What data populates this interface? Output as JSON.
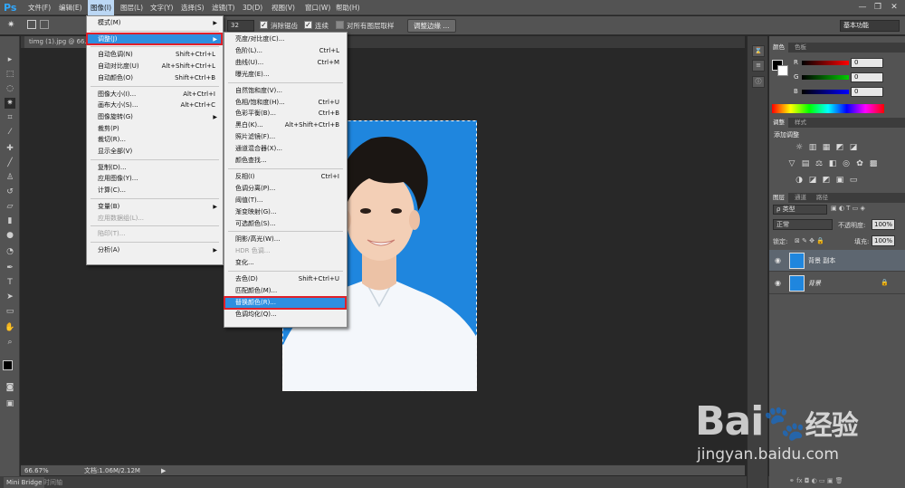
{
  "app": {
    "logo": "Ps"
  },
  "menubar": {
    "items": [
      "文件(F)",
      "编辑(E)",
      "图像(I)",
      "图层(L)",
      "文字(Y)",
      "选择(S)",
      "滤镜(T)",
      "3D(D)",
      "视图(V)",
      "窗口(W)",
      "帮助(H)"
    ],
    "active_index": 2,
    "window_controls": [
      "—",
      "❐",
      "✕"
    ]
  },
  "options": {
    "tolerance": "32",
    "antialias_label": "消除锯齿",
    "contiguous_label": "连续",
    "sample_all_label": "对所有图层取样",
    "refine_edge_label": "调整边缘 ...",
    "workspace_value": "基本功能"
  },
  "document": {
    "tab_title": "timg (1).jpg @ 66.7..."
  },
  "status": {
    "zoom": "66.67%",
    "doc_info": "文档:1.06M/2.12M"
  },
  "bottom_tabs": [
    "Mini Bridge",
    "时间轴"
  ],
  "image_menu": {
    "items": [
      {
        "label": "模式(M)",
        "submenu": true
      },
      {
        "sep": true
      },
      {
        "label": "调整(J)",
        "submenu": true,
        "highlight": true
      },
      {
        "sep": true
      },
      {
        "label": "自动色调(N)",
        "shortcut": "Shift+Ctrl+L"
      },
      {
        "label": "自动对比度(U)",
        "shortcut": "Alt+Shift+Ctrl+L"
      },
      {
        "label": "自动颜色(O)",
        "shortcut": "Shift+Ctrl+B"
      },
      {
        "sep": true
      },
      {
        "label": "图像大小(I)...",
        "shortcut": "Alt+Ctrl+I"
      },
      {
        "label": "画布大小(S)...",
        "shortcut": "Alt+Ctrl+C"
      },
      {
        "label": "图像旋转(G)",
        "submenu": true
      },
      {
        "label": "裁剪(P)"
      },
      {
        "label": "裁切(R)..."
      },
      {
        "label": "显示全部(V)"
      },
      {
        "sep": true
      },
      {
        "label": "复制(D)..."
      },
      {
        "label": "应用图像(Y)..."
      },
      {
        "label": "计算(C)..."
      },
      {
        "sep": true
      },
      {
        "label": "变量(B)",
        "submenu": true
      },
      {
        "label": "应用数据组(L)...",
        "disabled": true
      },
      {
        "sep": true
      },
      {
        "label": "陷印(T)...",
        "disabled": true
      },
      {
        "sep": true
      },
      {
        "label": "分析(A)",
        "submenu": true
      }
    ]
  },
  "adjust_menu": {
    "items": [
      {
        "label": "亮度/对比度(C)..."
      },
      {
        "label": "色阶(L)...",
        "shortcut": "Ctrl+L"
      },
      {
        "label": "曲线(U)...",
        "shortcut": "Ctrl+M"
      },
      {
        "label": "曝光度(E)..."
      },
      {
        "sep": true
      },
      {
        "label": "自然饱和度(V)..."
      },
      {
        "label": "色相/饱和度(H)...",
        "shortcut": "Ctrl+U"
      },
      {
        "label": "色彩平衡(B)...",
        "shortcut": "Ctrl+B"
      },
      {
        "label": "黑白(K)...",
        "shortcut": "Alt+Shift+Ctrl+B"
      },
      {
        "label": "照片滤镜(F)..."
      },
      {
        "label": "通道混合器(X)..."
      },
      {
        "label": "颜色查找..."
      },
      {
        "sep": true
      },
      {
        "label": "反相(I)",
        "shortcut": "Ctrl+I"
      },
      {
        "label": "色调分离(P)..."
      },
      {
        "label": "阈值(T)..."
      },
      {
        "label": "渐变映射(G)..."
      },
      {
        "label": "可选颜色(S)..."
      },
      {
        "sep": true
      },
      {
        "label": "阴影/高光(W)..."
      },
      {
        "label": "HDR 色调...",
        "disabled": true
      },
      {
        "label": "变化..."
      },
      {
        "sep": true
      },
      {
        "label": "去色(D)",
        "shortcut": "Shift+Ctrl+U"
      },
      {
        "label": "匹配颜色(M)..."
      },
      {
        "label": "替换颜色(R)...",
        "highlight": true
      },
      {
        "label": "色调均化(Q)..."
      }
    ]
  },
  "color_panel": {
    "tabs": [
      "颜色",
      "色板"
    ],
    "channels": [
      {
        "label": "R",
        "value": "0"
      },
      {
        "label": "G",
        "value": "0"
      },
      {
        "label": "B",
        "value": "0"
      }
    ]
  },
  "adjust_panel": {
    "tabs": [
      "调整",
      "样式"
    ],
    "title": "添加调整"
  },
  "layers_panel": {
    "tabs": [
      "图层",
      "通道",
      "路径"
    ],
    "filter_label": "ρ 类型",
    "blend_mode": "正常",
    "opacity_label": "不透明度:",
    "opacity_value": "100%",
    "lock_label": "锁定:",
    "fill_label": "填充:",
    "fill_value": "100%",
    "layers": [
      {
        "name": "背景 副本",
        "selected": true
      },
      {
        "name": "背景",
        "locked": true
      }
    ]
  },
  "watermark": {
    "brand": "Bai",
    "brand_cn": "经验",
    "url": "jingyan.baidu.com"
  },
  "colors": {
    "accent": "#2e8fe0",
    "highlight_border": "#e0202a",
    "photo_bg": "#1f86de"
  }
}
